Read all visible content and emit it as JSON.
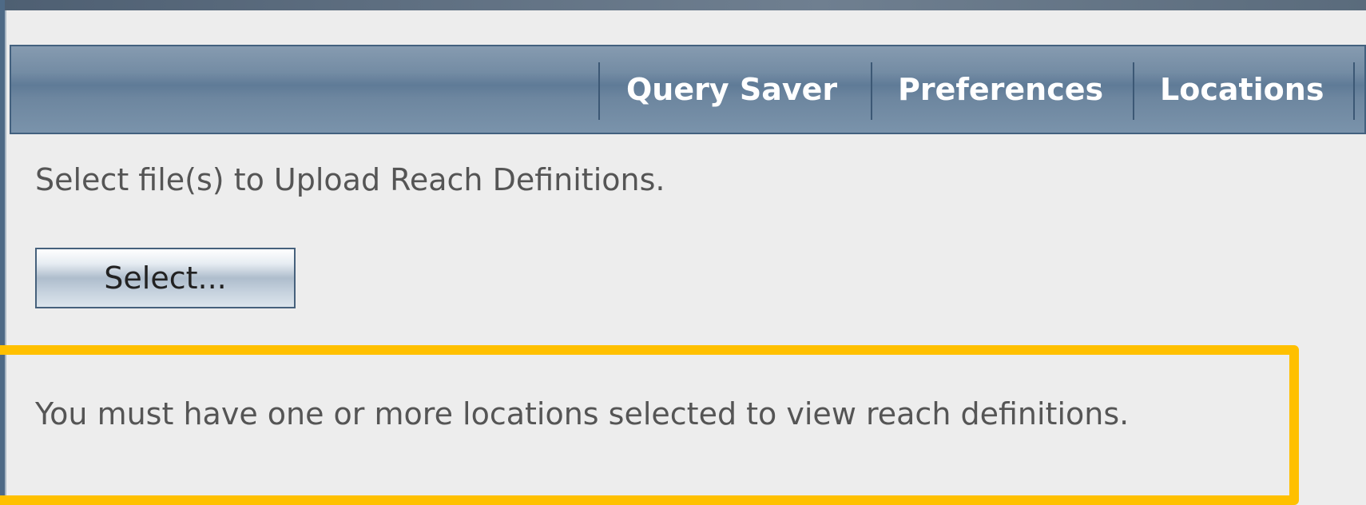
{
  "nav": {
    "items": [
      {
        "label": "Query Saver"
      },
      {
        "label": "Preferences"
      },
      {
        "label": "Locations"
      }
    ]
  },
  "upload": {
    "instruction": "Select file(s) to Upload Reach Definitions.",
    "select_label": "Select..."
  },
  "notice": {
    "message": "You must have one or more locations selected to view reach definitions.",
    "highlight_color": "#ffc000"
  },
  "colors": {
    "nav_bar": "#6d869f",
    "nav_text": "#ffffff",
    "background": "#ededed",
    "body_text": "#555555"
  }
}
